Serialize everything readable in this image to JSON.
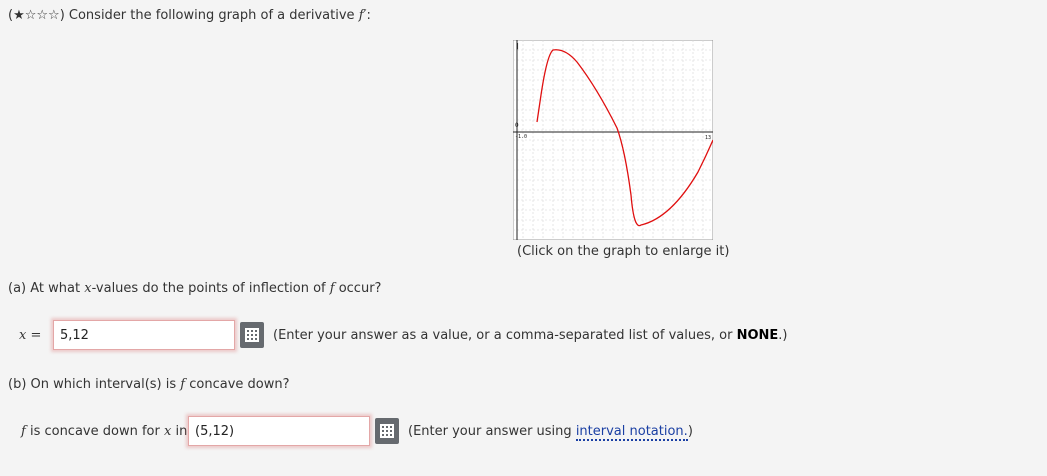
{
  "header": {
    "stars": "(★☆☆☆)",
    "prompt": "Consider the following graph of a derivative",
    "fprime": "f′",
    "colon": ":"
  },
  "graph": {
    "caption": "(Click on the graph to enlarge it)",
    "axis_labels": {
      "x_min": "-1.0",
      "x_max": "13",
      "y_origin": "0"
    },
    "curve_color": "#e01010"
  },
  "part_a": {
    "question_pre": "(a) At what",
    "question_var": "x",
    "question_mid": "-values do the points of inflection of",
    "question_f": "f",
    "question_post": "occur?",
    "input_label_var": "x",
    "input_label_eq": "=",
    "input_value": "5,12",
    "hint_pre": "(Enter your answer as a value, or a comma-separated list of values, or",
    "hint_bold": "NONE",
    "hint_post": ".)"
  },
  "part_b": {
    "question_pre": "(b) On which interval(s) is",
    "question_f": "f",
    "question_post": "concave down?",
    "label_f": "f",
    "label_mid": "is concave down for",
    "label_x": "x",
    "label_in": "in",
    "input_value": "(5,12)",
    "hint_pre": "(Enter your answer using",
    "hint_link": "interval notation.",
    "hint_post": ")"
  }
}
